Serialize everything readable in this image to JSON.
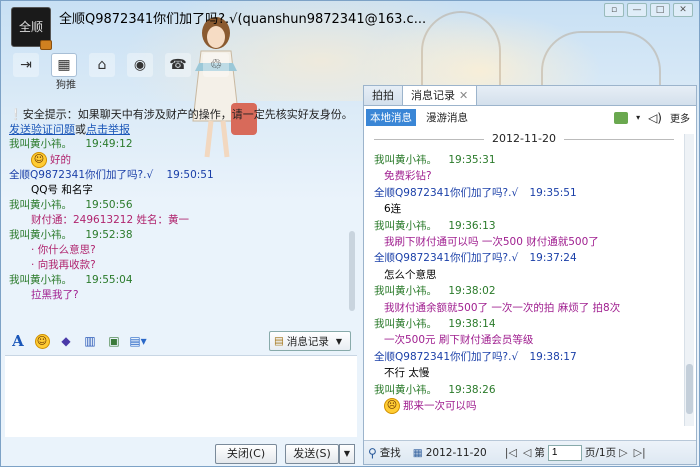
{
  "window": {
    "avatar_text": "全顺",
    "title": "全顺Q9872341你们加了吗?.√(quanshun9872341@163.c...",
    "toolbar_label": "狗推"
  },
  "left_chat": {
    "safety_prefix": "安全提示：如果聊天中有涉及财产的操作，请一定先核实好友身份。",
    "safety_link1": "发送验证问题",
    "safety_or": "或",
    "safety_link2": "点击举报",
    "messages": [
      {
        "sender": "我叫黄小祎。",
        "time": "19:49:12",
        "kind": "self",
        "text": "好的",
        "emoji": true,
        "color": "pink"
      },
      {
        "sender": "全顺Q9872341你们加了吗?.√",
        "time": "19:50:51",
        "kind": "other",
        "text": "QQ号 和名字",
        "color": "black"
      },
      {
        "sender": "我叫黄小祎。",
        "time": "19:50:56",
        "kind": "self",
        "text": "财付通：249613212 姓名：黄一",
        "color": "pink"
      },
      {
        "sender": "我叫黄小祎。",
        "time": "19:52:38",
        "kind": "self",
        "text": "你什么意思?",
        "text2": "向我再收款?",
        "color": "pink"
      },
      {
        "sender": "我叫黄小祎。",
        "time": "19:55:04",
        "kind": "self",
        "text": "拉黑我了?",
        "color": "purple"
      }
    ]
  },
  "input_bar": {
    "msg_record_label": "消息记录",
    "close_label": "关闭(C)",
    "send_label": "发送(S)"
  },
  "right_panel": {
    "tabs": [
      {
        "label": "拍拍",
        "active": false
      },
      {
        "label": "消息记录",
        "active": true
      }
    ],
    "subtabs": [
      {
        "label": "本地消息",
        "active": true
      },
      {
        "label": "漫游消息",
        "active": false
      }
    ],
    "more_label": "更多",
    "date": "2012-11-20",
    "records": [
      {
        "sender": "我叫黄小祎。",
        "time": "19:35:31",
        "kind": "self",
        "text": "免费彩钻?",
        "color": "purple"
      },
      {
        "sender": "全顺Q9872341你们加了吗?.√",
        "time": "19:35:51",
        "kind": "other",
        "text": "6连",
        "color": "black"
      },
      {
        "sender": "我叫黄小祎。",
        "time": "19:36:13",
        "kind": "self",
        "text": "我刷下财付通可以吗 一次500 财付通就500了",
        "color": "purple"
      },
      {
        "sender": "全顺Q9872341你们加了吗?.√",
        "time": "19:37:24",
        "kind": "other",
        "text": "怎么个意思",
        "color": "black"
      },
      {
        "sender": "我叫黄小祎。",
        "time": "19:38:02",
        "kind": "self",
        "text": "我财付通余额就500了 一次一次的拍 麻烦了 拍8次",
        "color": "purple"
      },
      {
        "sender": "我叫黄小祎。",
        "time": "19:38:14",
        "kind": "self",
        "text": "一次500元 刷下财付通会员等级",
        "color": "purple"
      },
      {
        "sender": "全顺Q9872341你们加了吗?.√",
        "time": "19:38:17",
        "kind": "other",
        "text": "不行 太慢",
        "color": "black"
      },
      {
        "sender": "我叫黄小祎。",
        "time": "19:38:26",
        "kind": "self",
        "text": "那来一次可以吗",
        "color": "purple"
      }
    ],
    "footer": {
      "search_label": "查找",
      "date": "2012-11-20",
      "page_prefix": "第",
      "page_value": "1",
      "page_suffix": "页/1页"
    }
  },
  "colors": {
    "self_sender": "#2a7a2a",
    "other_sender": "#1a3fa8",
    "msg_pink": "#b0246e",
    "msg_purple": "#a02090",
    "accent": "#3a86d6"
  }
}
